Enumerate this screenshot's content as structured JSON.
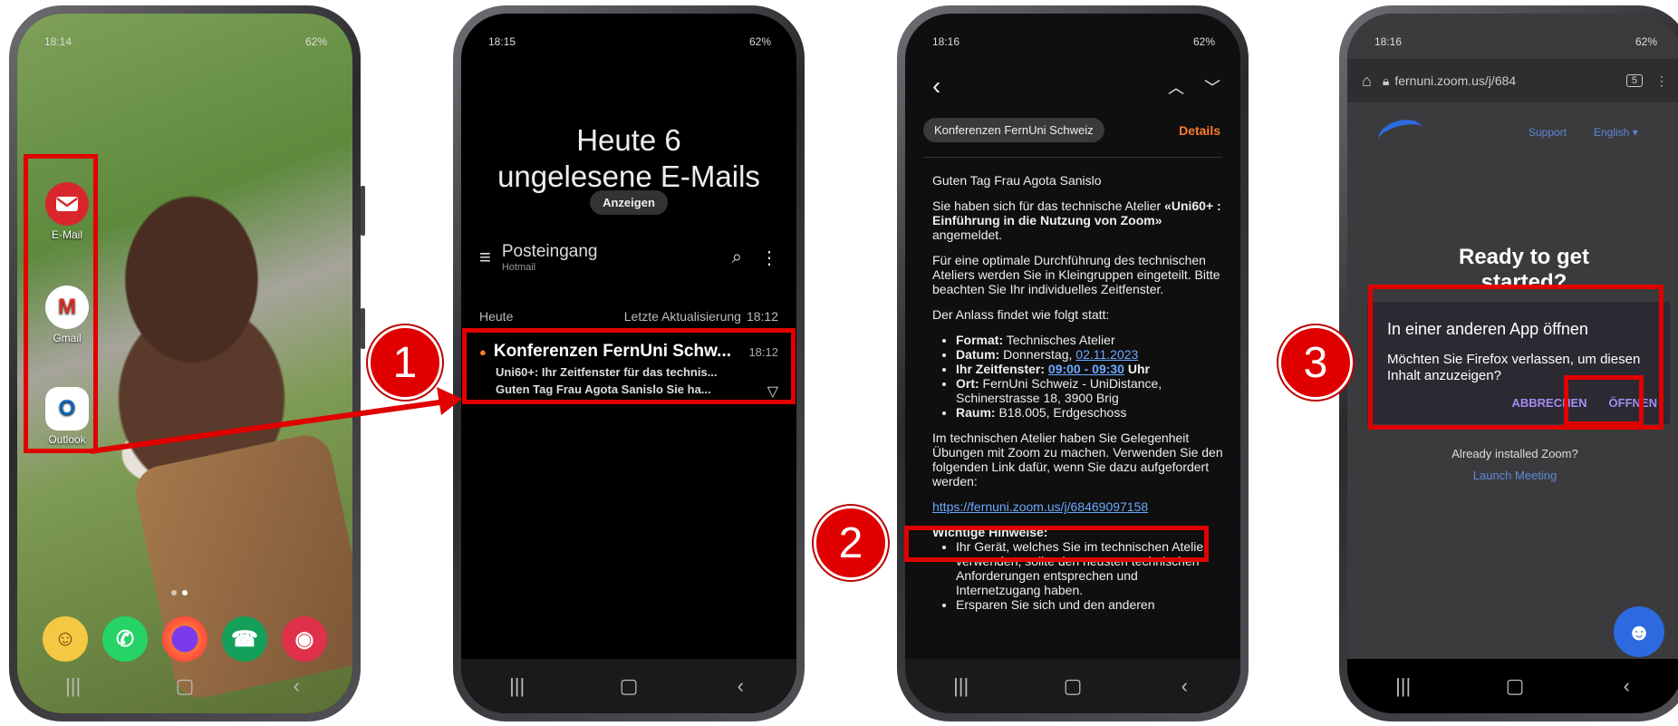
{
  "steps": [
    "1",
    "2",
    "3"
  ],
  "phone1": {
    "time": "18:14",
    "status": "62%",
    "apps": [
      {
        "label": "E-Mail",
        "icon": "email-icon",
        "color": "#d9262c"
      },
      {
        "label": "Gmail",
        "icon": "gmail-icon",
        "color": "#ffffff"
      },
      {
        "label": "Outlook",
        "icon": "outlook-icon",
        "color": "#0a64b4"
      }
    ],
    "dock": [
      "contacts-icon",
      "whatsapp-icon",
      "firefox-icon",
      "phone-icon",
      "camera-icon"
    ]
  },
  "phone2": {
    "time": "18:15",
    "status": "62%",
    "headline": "Heute 6 ungelesene E-Mails",
    "show_button": "Anzeigen",
    "folder": "Posteingang",
    "account": "Hotmail",
    "section": "Heute",
    "last_update": "Letzte Aktualisierung",
    "last_update_time": "18:12",
    "email": {
      "sender": "Konferenzen FernUni Schw...",
      "time": "18:12",
      "subject": "Uni60+: Ihr Zeitfenster für das technis...",
      "preview": "Guten Tag Frau Agota Sanislo   Sie ha..."
    }
  },
  "phone3": {
    "time": "18:16",
    "status": "62%",
    "sender_chip": "Konferenzen FernUni Schweiz",
    "details": "Details",
    "greeting": "Guten Tag Frau Agota Sanislo",
    "p1_a": "Sie haben sich für das technische Atelier ",
    "p1_b": "«Uni60+ : Einführung in die Nutzung von Zoom»",
    "p1_c": " angemeldet.",
    "p2": "Für eine optimale Durchführung des technischen Ateliers werden Sie in Kleingruppen eingeteilt. Bitte beachten Sie Ihr individuelles Zeitfenster.",
    "p3": "Der Anlass findet wie folgt statt:",
    "format_l": "Format:",
    "format_v": " Technisches Atelier",
    "datum_l": "Datum:",
    "datum_v": " Donnerstag, ",
    "datum_link": "02.11.2023",
    "zeit_l": "Ihr Zeitfenster:",
    "zeit_link": "09:00 - 09:30",
    "zeit_v": " Uhr",
    "ort_l": "Ort:",
    "ort_v": " FernUni Schweiz - UniDistance, Schinerstrasse 18, 3900 Brig",
    "raum_l": "Raum:",
    "raum_v": " B18.005, Erdgeschoss",
    "p4": "Im technischen Atelier haben Sie Gelegenheit Übungen mit Zoom zu machen. Verwenden Sie den folgenden Link dafür, wenn Sie dazu aufgefordert werden:",
    "link": "https://fernuni.zoom.us/j/68469097158",
    "hinweise": "Wichtige Hinweise:",
    "h1": "Ihr Gerät, welches Sie im technischen Atelier verwenden, sollte den neusten technischen Anforderungen entsprechen und Internetzugang haben.",
    "h2": "Ersparen Sie sich und den anderen"
  },
  "phone4": {
    "time": "18:16",
    "status": "62%",
    "url": "fernuni.zoom.us/j/684",
    "tabs": "5",
    "support": "Support",
    "language": "English",
    "ready": "Ready to get started?",
    "dialog_title": "In einer anderen App öffnen",
    "dialog_text": "Möchten Sie Firefox verlassen, um diesen Inhalt anzuzeigen?",
    "cancel": "ABBRECHEN",
    "open": "ÖFFNEN",
    "installed": "Already installed Zoom?",
    "launch": "Launch Meeting"
  }
}
